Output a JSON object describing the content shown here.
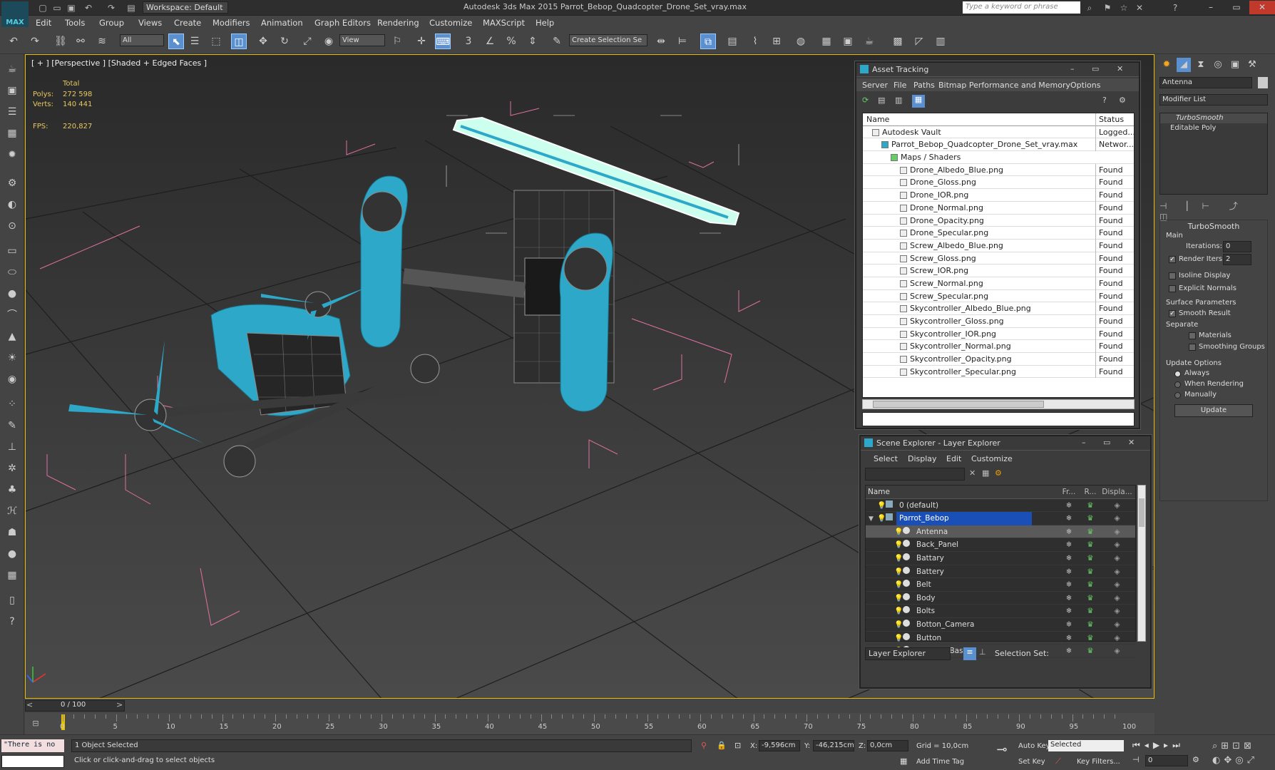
{
  "app": {
    "title": "Autodesk 3ds Max  2015     Parrot_Bebop_Quadcopter_Drone_Set_vray.max",
    "logo": "MAX",
    "workspace": "Workspace: Default",
    "search_placeholder": "Type a keyword or phrase"
  },
  "menu": [
    "Edit",
    "Tools",
    "Group",
    "Views",
    "Create",
    "Modifiers",
    "Animation",
    "Graph Editors",
    "Rendering",
    "Customize",
    "MAXScript",
    "Help"
  ],
  "toolbar": {
    "selection_filter": "All",
    "ref_coord": "View",
    "named_selection": "Create Selection Se",
    "snap_labels": [
      "3",
      "%"
    ]
  },
  "viewport": {
    "label": "[ + ] [Perspective ] [Shaded + Edged Faces ]",
    "stats_header": "Total",
    "polys_label": "Polys:",
    "polys_value": "272 598",
    "verts_label": "Verts:",
    "verts_value": "140 441",
    "fps_label": "FPS:",
    "fps_value": "220,827",
    "frame_counter": "0 / 100"
  },
  "command_panel": {
    "object_name": "Antenna",
    "modifier_list": "Modifier List",
    "stack": [
      "TurboSmooth",
      "Editable Poly"
    ],
    "rollout_title": "TurboSmooth",
    "main_label": "Main",
    "iterations_label": "Iterations:",
    "iterations_value": "0",
    "render_iters_label": "Render Iters:",
    "render_iters_value": "2",
    "isoline_label": "Isoline Display",
    "explicit_label": "Explicit Normals",
    "surface_label": "Surface Parameters",
    "smooth_result_label": "Smooth Result",
    "separate_label": "Separate",
    "materials_label": "Materials",
    "smoothing_label": "Smoothing Groups",
    "update_options_label": "Update Options",
    "always_label": "Always",
    "when_rendering_label": "When Rendering",
    "manually_label": "Manually",
    "update_button": "Update"
  },
  "asset_tracking": {
    "title": "Asset Tracking",
    "menu": [
      "Server",
      "File",
      "Paths",
      "Bitmap Performance and Memory",
      "Options"
    ],
    "col_name": "Name",
    "col_status": "Status",
    "rows": [
      {
        "name": "Autodesk Vault",
        "status": "Logged...",
        "indent": 1
      },
      {
        "name": "Parrot_Bebop_Quadcopter_Drone_Set_vray.max",
        "status": "Networ...",
        "indent": 2
      },
      {
        "name": "Maps / Shaders",
        "status": "",
        "indent": 3
      },
      {
        "name": "Drone_Albedo_Blue.png",
        "status": "Found",
        "indent": 4
      },
      {
        "name": "Drone_Gloss.png",
        "status": "Found",
        "indent": 4
      },
      {
        "name": "Drone_IOR.png",
        "status": "Found",
        "indent": 4
      },
      {
        "name": "Drone_Normal.png",
        "status": "Found",
        "indent": 4
      },
      {
        "name": "Drone_Opacity.png",
        "status": "Found",
        "indent": 4
      },
      {
        "name": "Drone_Specular.png",
        "status": "Found",
        "indent": 4
      },
      {
        "name": "Screw_Albedo_Blue.png",
        "status": "Found",
        "indent": 4
      },
      {
        "name": "Screw_Gloss.png",
        "status": "Found",
        "indent": 4
      },
      {
        "name": "Screw_IOR.png",
        "status": "Found",
        "indent": 4
      },
      {
        "name": "Screw_Normal.png",
        "status": "Found",
        "indent": 4
      },
      {
        "name": "Screw_Specular.png",
        "status": "Found",
        "indent": 4
      },
      {
        "name": "Skycontroller_Albedo_Blue.png",
        "status": "Found",
        "indent": 4
      },
      {
        "name": "Skycontroller_Gloss.png",
        "status": "Found",
        "indent": 4
      },
      {
        "name": "Skycontroller_IOR.png",
        "status": "Found",
        "indent": 4
      },
      {
        "name": "Skycontroller_Normal.png",
        "status": "Found",
        "indent": 4
      },
      {
        "name": "Skycontroller_Opacity.png",
        "status": "Found",
        "indent": 4
      },
      {
        "name": "Skycontroller_Specular.png",
        "status": "Found",
        "indent": 4
      }
    ]
  },
  "scene_explorer": {
    "title": "Scene Explorer - Layer Explorer",
    "menu": [
      "Select",
      "Display",
      "Edit",
      "Customize"
    ],
    "col_name": "Name",
    "col_fr": "Fr...",
    "col_r": "R...",
    "col_disp": "Displa...",
    "rows": [
      {
        "name": "0 (default)",
        "level": 0,
        "selected": false
      },
      {
        "name": "Parrot_Bebop",
        "level": 0,
        "selected": true
      },
      {
        "name": "Antenna",
        "level": 1,
        "selected": false,
        "highlight": true
      },
      {
        "name": "Back_Panel",
        "level": 1
      },
      {
        "name": "Battary",
        "level": 1
      },
      {
        "name": "Battery",
        "level": 1
      },
      {
        "name": "Belt",
        "level": 1
      },
      {
        "name": "Body",
        "level": 1
      },
      {
        "name": "Bolts",
        "level": 1
      },
      {
        "name": "Botton_Camera",
        "level": 1
      },
      {
        "name": "Button",
        "level": 1
      },
      {
        "name": "Camera_Base",
        "level": 1
      }
    ],
    "footer_combo": "Layer Explorer",
    "selection_set_label": "Selection Set:"
  },
  "timeline": {
    "ticks": [
      "0",
      "5",
      "10",
      "15",
      "20",
      "25",
      "30",
      "35",
      "40",
      "45",
      "50",
      "55",
      "60",
      "65",
      "70",
      "75",
      "80",
      "85",
      "90",
      "95",
      "100"
    ]
  },
  "status": {
    "maxscript": "\"There is no",
    "selected": "1 Object Selected",
    "prompt": "Click or click-and-drag to select objects",
    "x_label": "X:",
    "x_value": "-9,596cm",
    "y_label": "Y:",
    "y_value": "-46,215cm",
    "z_label": "Z:",
    "z_value": "0,0cm",
    "grid": "Grid = 10,0cm",
    "add_time_tag": "Add Time Tag",
    "auto_key": "Auto Key",
    "set_key": "Set Key",
    "key_mode": "Selected",
    "key_filters": "Key Filters...",
    "frame": "0"
  },
  "colors": {
    "accent": "#2ea8c8",
    "selection": "#5a8fd0",
    "layer_selected": "#1a4fb8",
    "bbox": "#e070a0"
  }
}
